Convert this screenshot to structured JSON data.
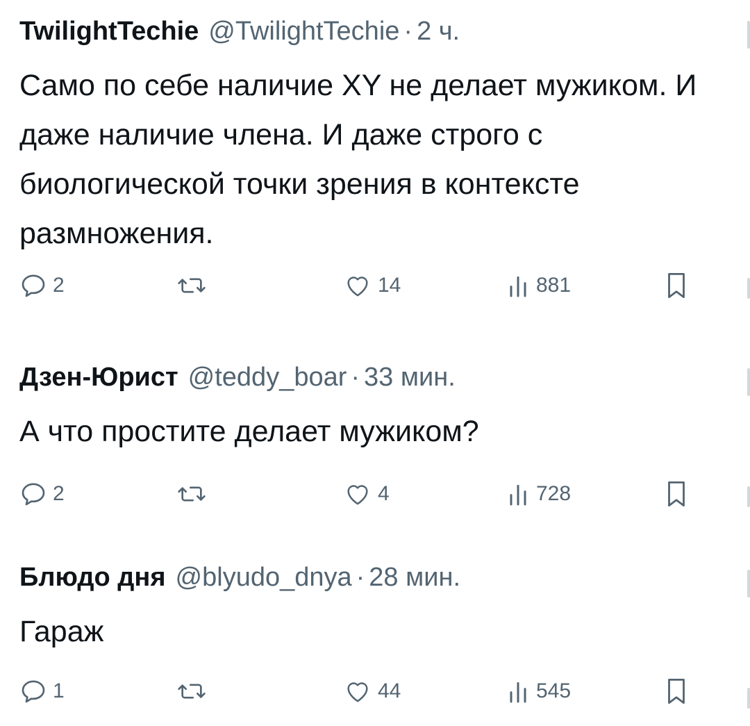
{
  "tweets": [
    {
      "author_name": "TwilightTechie",
      "author_handle": "@TwilightTechie",
      "separator": "·",
      "time": "2 ч.",
      "text": "Само по себе наличие XY не делает мужиком. И даже наличие члена. И даже строго с биологической точки зрения в контексте размножения.",
      "replies": "2",
      "likes": "14",
      "views": "881"
    },
    {
      "author_name": "Дзен-Юрист",
      "author_handle": "@teddy_boar",
      "separator": "·",
      "time": "33 мин.",
      "text": "А что простите делает мужиком?",
      "replies": "2",
      "likes": "4",
      "views": "728"
    },
    {
      "author_name": "Блюдо дня",
      "author_handle": "@blyudo_dnya",
      "separator": "·",
      "time": "28 мин.",
      "text": "Гараж",
      "replies": "1",
      "likes": "44",
      "views": "545"
    }
  ],
  "icons": {
    "reply": "reply-icon",
    "retweet": "retweet-icon",
    "like": "heart-icon",
    "views": "views-icon",
    "bookmark": "bookmark-icon"
  },
  "colors": {
    "text": "#0f1419",
    "secondary": "#536471",
    "background": "#ffffff"
  }
}
